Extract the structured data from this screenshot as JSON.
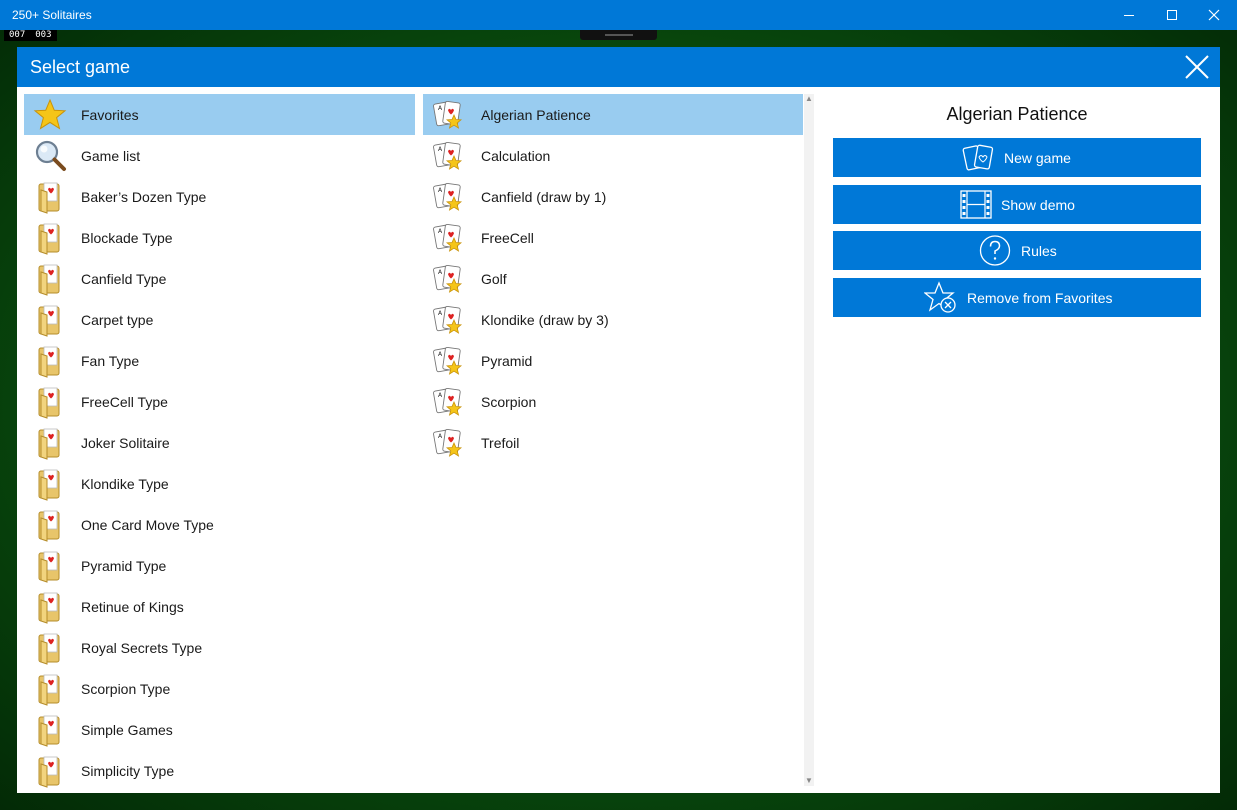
{
  "window": {
    "title": "250+ Solitaires",
    "counters": [
      "007",
      "003"
    ]
  },
  "dialog": {
    "title": "Select game"
  },
  "categories": [
    {
      "label": "Favorites",
      "icon": "star-icon",
      "selected": true
    },
    {
      "label": "Game list",
      "icon": "magnifier-icon",
      "selected": false
    },
    {
      "label": "Baker’s Dozen Type",
      "icon": "folder-icon",
      "selected": false
    },
    {
      "label": "Blockade Type",
      "icon": "folder-icon",
      "selected": false
    },
    {
      "label": "Canfield Type",
      "icon": "folder-icon",
      "selected": false
    },
    {
      "label": "Carpet type",
      "icon": "folder-icon",
      "selected": false
    },
    {
      "label": "Fan Type",
      "icon": "folder-icon",
      "selected": false
    },
    {
      "label": "FreeCell Type",
      "icon": "folder-icon",
      "selected": false
    },
    {
      "label": "Joker Solitaire",
      "icon": "folder-icon",
      "selected": false
    },
    {
      "label": "Klondike Type",
      "icon": "folder-icon",
      "selected": false
    },
    {
      "label": "One Card Move Type",
      "icon": "folder-icon",
      "selected": false
    },
    {
      "label": "Pyramid Type",
      "icon": "folder-icon",
      "selected": false
    },
    {
      "label": "Retinue of Kings",
      "icon": "folder-icon",
      "selected": false
    },
    {
      "label": "Royal Secrets Type",
      "icon": "folder-icon",
      "selected": false
    },
    {
      "label": "Scorpion Type",
      "icon": "folder-icon",
      "selected": false
    },
    {
      "label": "Simple Games",
      "icon": "folder-icon",
      "selected": false
    },
    {
      "label": "Simplicity Type",
      "icon": "folder-icon",
      "selected": false
    }
  ],
  "games": [
    {
      "label": "Algerian Patience",
      "icon": "favorite-cards-icon",
      "selected": true
    },
    {
      "label": "Calculation",
      "icon": "favorite-cards-icon",
      "selected": false
    },
    {
      "label": "Canfield (draw by 1)",
      "icon": "favorite-cards-icon",
      "selected": false
    },
    {
      "label": "FreeCell",
      "icon": "favorite-cards-icon",
      "selected": false
    },
    {
      "label": "Golf",
      "icon": "favorite-cards-icon",
      "selected": false
    },
    {
      "label": "Klondike (draw by 3)",
      "icon": "favorite-cards-icon",
      "selected": false
    },
    {
      "label": "Pyramid",
      "icon": "favorite-cards-icon",
      "selected": false
    },
    {
      "label": "Scorpion",
      "icon": "favorite-cards-icon",
      "selected": false
    },
    {
      "label": "Trefoil",
      "icon": "favorite-cards-icon",
      "selected": false
    }
  ],
  "detail": {
    "title": "Algerian Patience",
    "actions": [
      {
        "label": "New game",
        "icon": "cards-icon"
      },
      {
        "label": "Show demo",
        "icon": "film-icon"
      },
      {
        "label": "Rules",
        "icon": "question-icon"
      },
      {
        "label": "Remove from Favorites",
        "icon": "star-remove-icon"
      }
    ]
  },
  "colors": {
    "accent": "#0078d7",
    "selection": "#99ccf0",
    "felt": "#0a5410"
  }
}
